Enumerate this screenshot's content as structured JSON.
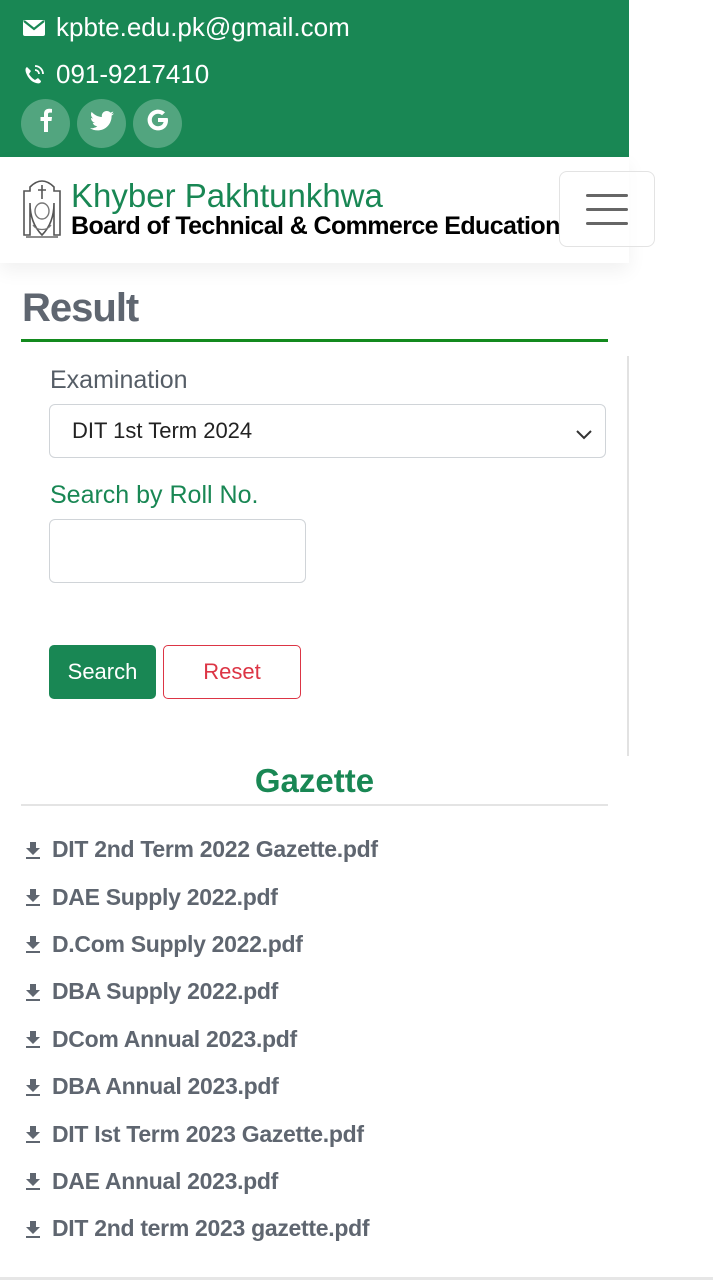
{
  "topbar": {
    "email": "kpbte.edu.pk@gmail.com",
    "phone": "091-9217410",
    "socials": [
      {
        "name": "facebook",
        "glyph": "f"
      },
      {
        "name": "twitter",
        "glyph": "twitter-bird"
      },
      {
        "name": "google",
        "glyph": "G"
      }
    ],
    "bg_color": "#198754"
  },
  "navbar": {
    "brand_title": "Khyber Pakhtunkhwa",
    "brand_subtitle": "Board of Technical & Commerce Education",
    "menu_icon": "hamburger-icon"
  },
  "result": {
    "title": "Result",
    "examination_label": "Examination",
    "examination_selected": "DIT 1st Term 2024",
    "roll_label": "Search by Roll No.",
    "roll_value": "",
    "search_button": "Search",
    "reset_button": "Reset"
  },
  "gazette": {
    "title": "Gazette",
    "items": [
      "DIT 2nd Term 2022 Gazette.pdf",
      "DAE Supply 2022.pdf",
      "D.Com Supply 2022.pdf",
      "DBA Supply 2022.pdf",
      "DCom Annual 2023.pdf",
      "DBA Annual 2023.pdf",
      "DIT Ist Term 2023 Gazette.pdf",
      "DAE Annual 2023.pdf",
      "DIT 2nd term 2023 gazette.pdf"
    ]
  },
  "colors": {
    "primary": "#198754",
    "danger": "#dc3545",
    "muted_text": "#5f6670",
    "accent_rule": "#138a1e"
  }
}
